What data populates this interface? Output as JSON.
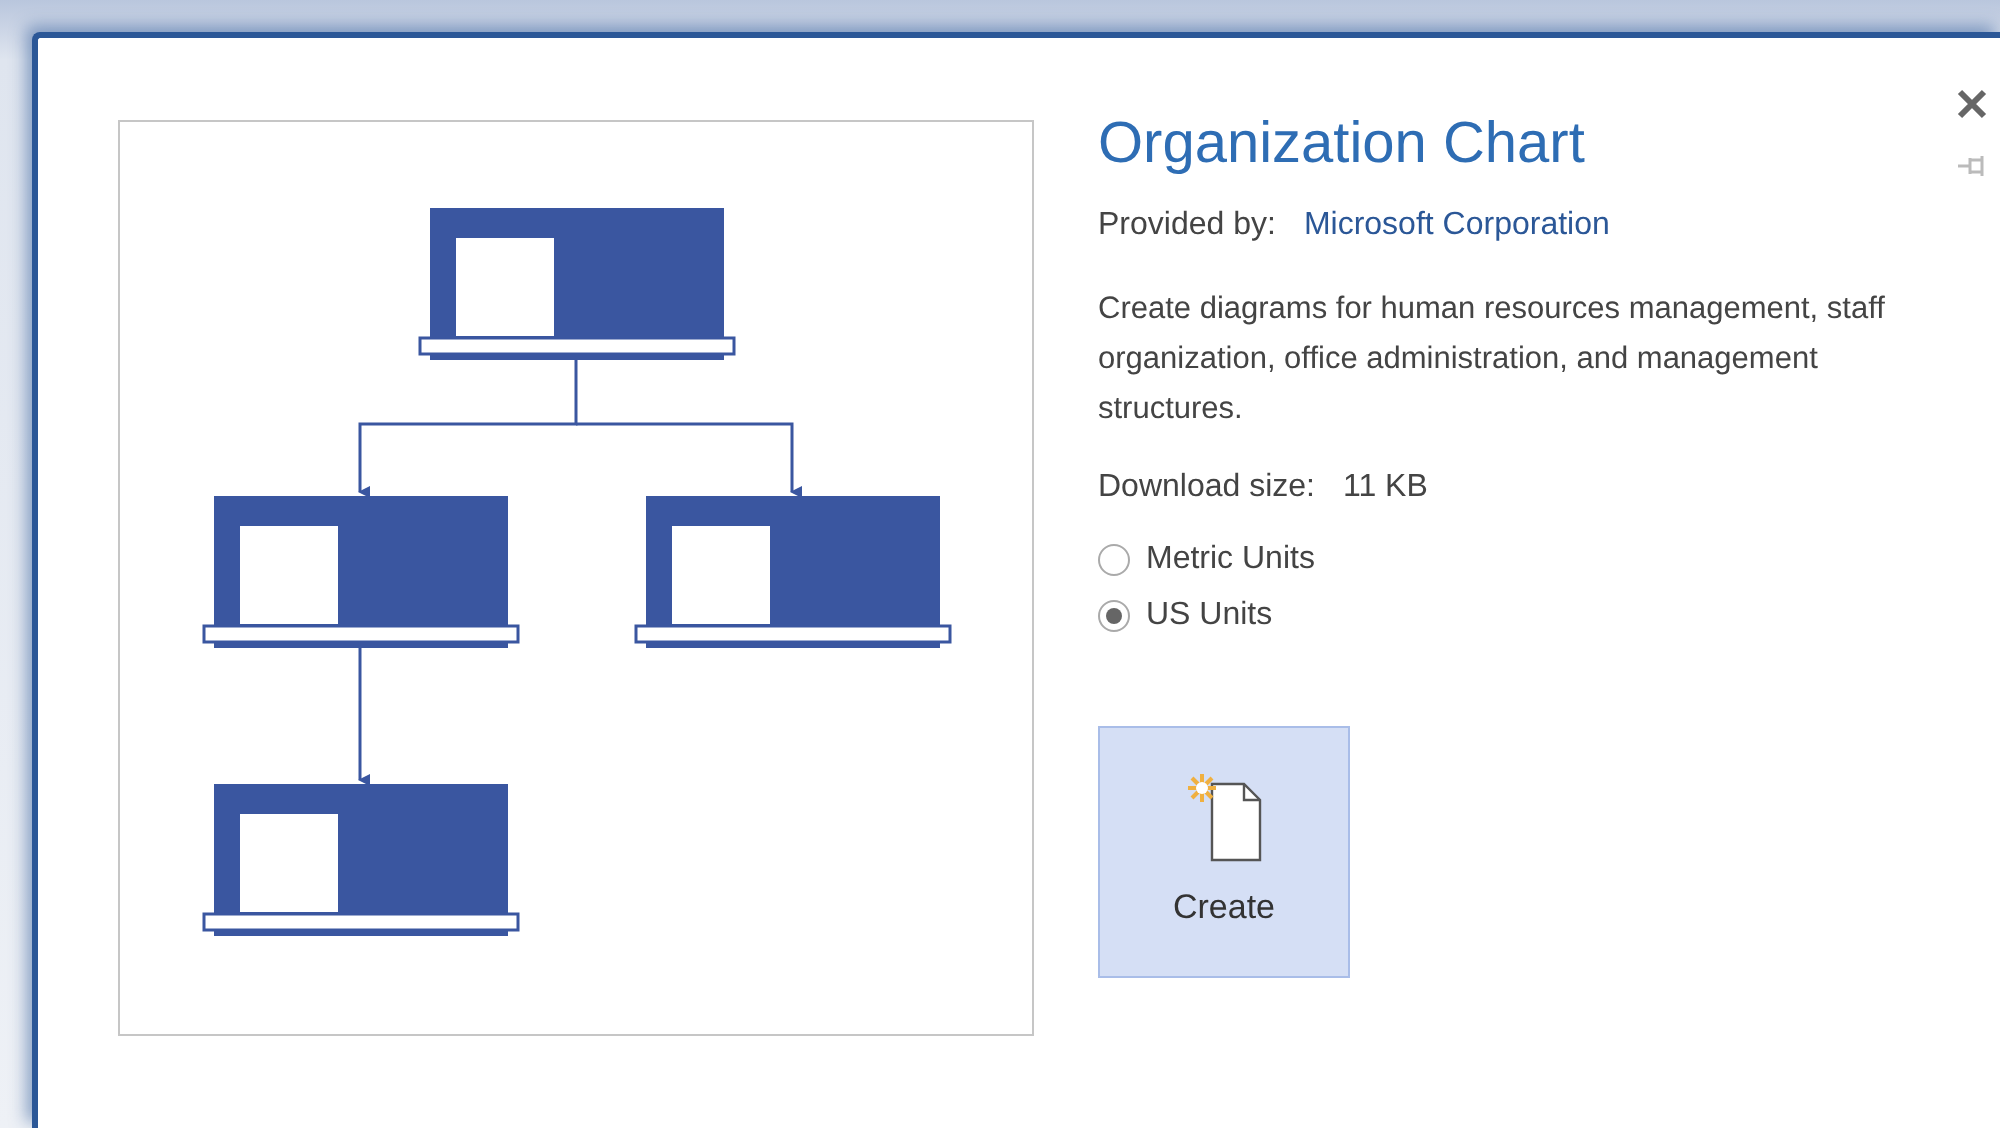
{
  "title": "Organization Chart",
  "provider": {
    "label": "Provided by:",
    "name": "Microsoft Corporation"
  },
  "description": "Create diagrams for human resources management, staff organization, office administration, and management structures.",
  "download": {
    "label": "Download size:",
    "value": "11 KB"
  },
  "units": [
    {
      "label": "Metric Units",
      "selected": false
    },
    {
      "label": "US Units",
      "selected": true
    }
  ],
  "create_button": {
    "label": "Create"
  }
}
